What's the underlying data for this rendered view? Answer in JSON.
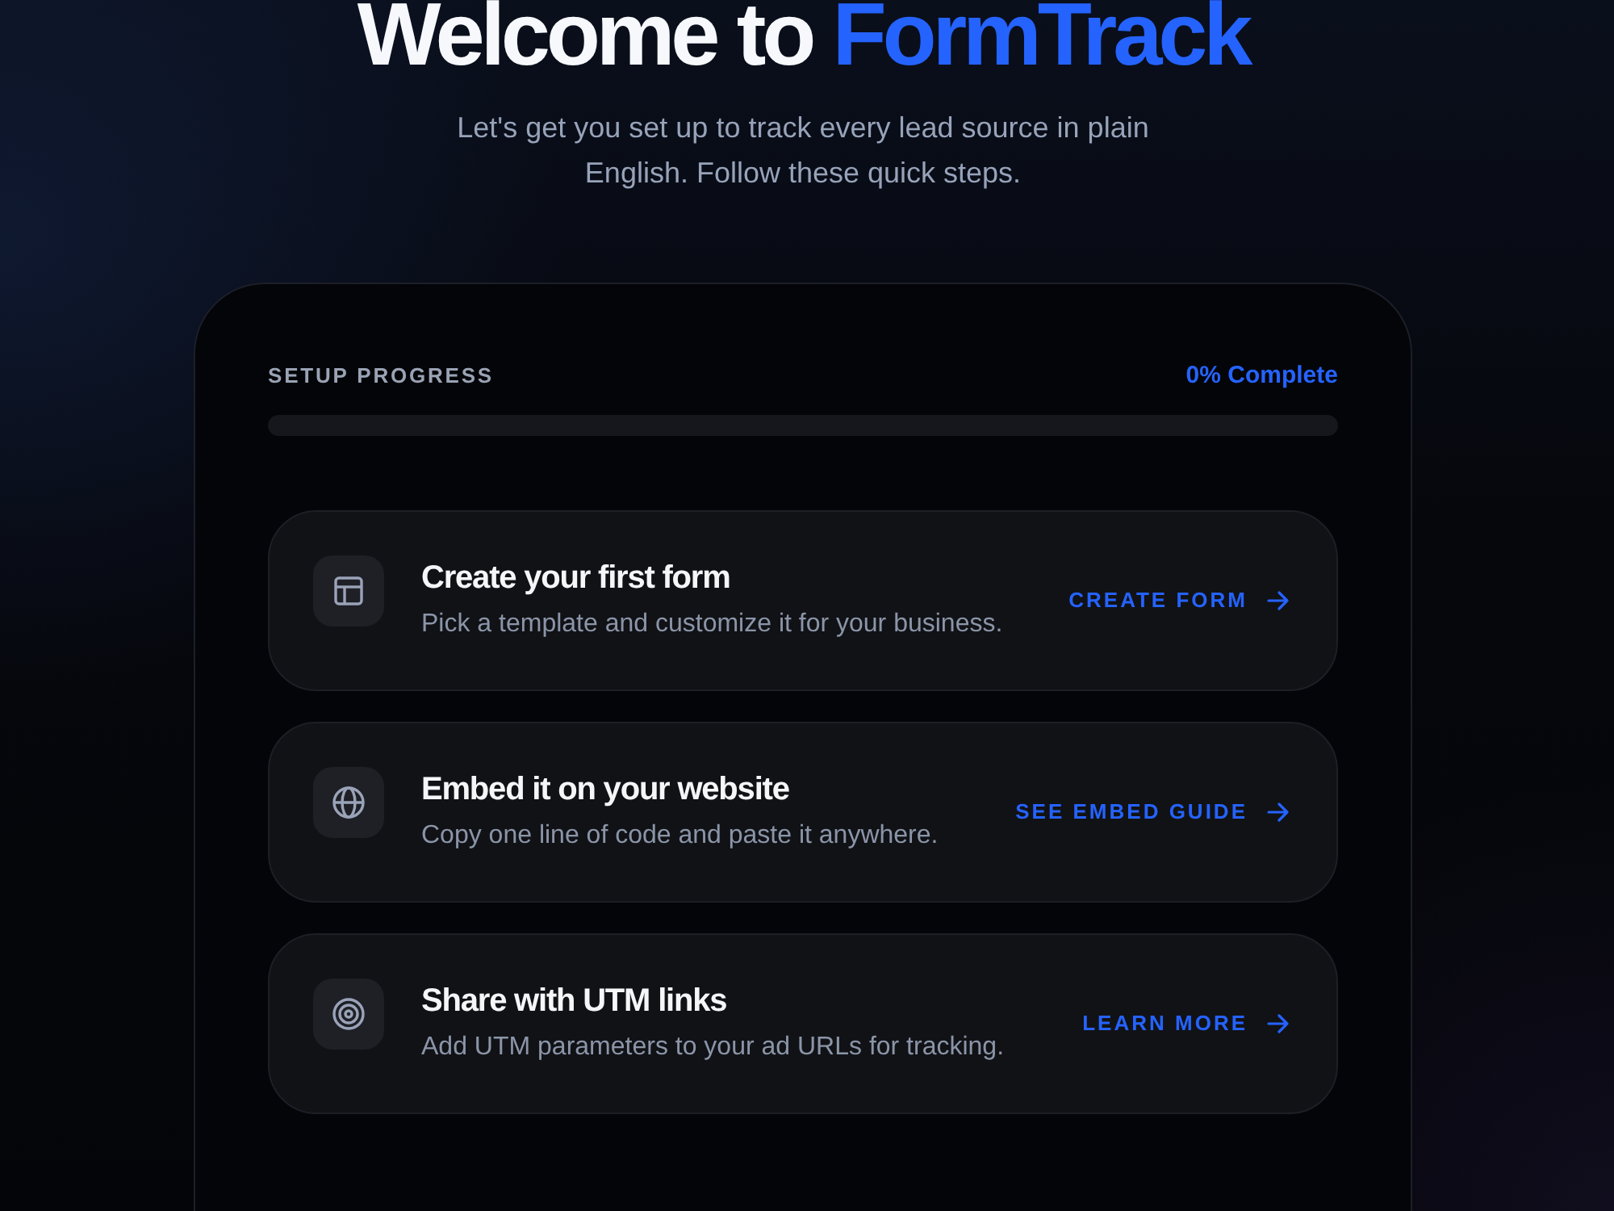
{
  "header": {
    "title": "Welcome to",
    "title_highlight": "FormTrack",
    "subtitle": "Let's get you set up to track every lead source in plain English. Follow these quick steps."
  },
  "progress": {
    "label": "SETUP PROGRESS",
    "reading": "0% Complete",
    "level": 0
  },
  "steps": [
    {
      "kind": "layout",
      "title": "Create your first form",
      "description": "Pick a template and customize it for your business.",
      "action": "CREATE FORM"
    },
    {
      "kind": "globe",
      "title": "Embed it on your website",
      "description": "Copy one line of code and paste it anywhere.",
      "action": "SEE EMBED GUIDE"
    },
    {
      "kind": "target",
      "title": "Share with UTM links",
      "description": "Add UTM parameters to your ad URLs for tracking.",
      "action": "LEARN MORE"
    }
  ]
}
